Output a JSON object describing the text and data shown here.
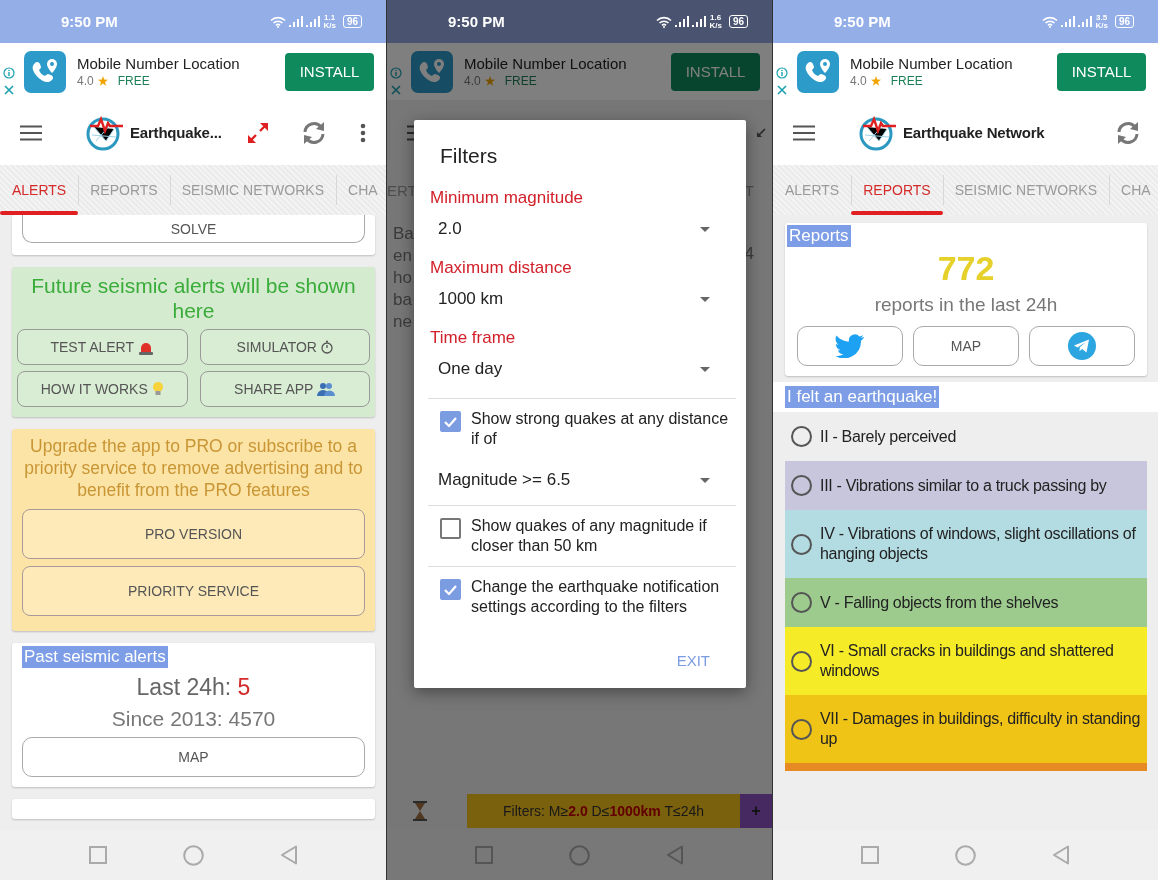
{
  "screens": [
    {
      "kind": "alerts",
      "status_bar": {
        "time": "9:50 PM",
        "speed": "1.1",
        "speed_unit": "K/s",
        "battery": "96"
      },
      "ad": {
        "title": "Mobile Number Location",
        "rating": "4.0",
        "price": "FREE",
        "button": "INSTALL"
      },
      "toolbar": {
        "title": "Earthquake..."
      },
      "tabs": [
        {
          "label": "ALERTS",
          "selected": true
        },
        {
          "label": "REPORTS",
          "selected": false
        },
        {
          "label": "SEISMIC NETWORKS",
          "selected": false
        },
        {
          "label": "CHA",
          "selected": false
        }
      ],
      "solve_button": "SOLVE",
      "future_card": {
        "message": "Future seismic alerts will be shown here",
        "buttons": [
          {
            "label": "TEST ALERT",
            "kind": "siren"
          },
          {
            "label": "SIMULATOR",
            "kind": "timer"
          },
          {
            "label": "HOW IT WORKS",
            "kind": "bulb"
          },
          {
            "label": "SHARE APP",
            "kind": "people"
          }
        ]
      },
      "upgrade_card": {
        "message": "Upgrade the app to PRO or subscribe to a priority service to remove advertising and to benefit from the PRO features",
        "buttons": [
          "PRO VERSION",
          "PRIORITY SERVICE"
        ]
      },
      "past_alerts": {
        "title": "Past seismic alerts",
        "last_label": "Last 24h:",
        "last_value": "5",
        "since": "Since 2013: 4570",
        "button": "MAP"
      }
    },
    {
      "kind": "filters",
      "status_bar": {
        "time": "9:50 PM",
        "speed": "1.6",
        "speed_unit": "K/s",
        "battery": "96"
      },
      "ad": {
        "title": "Mobile Number Location",
        "rating": "4.0",
        "price": "FREE",
        "button": "INSTALL"
      },
      "background": {
        "tab_fragments": [
          "ERT",
          "T"
        ],
        "text_fragments": [
          "Ba",
          "en",
          "ho",
          "ba",
          "ne"
        ],
        "side_fragment": "4",
        "filter_bar": "Filters: M≥**2.0** D≤**1000km** T≤24h",
        "add_button": "+"
      },
      "dialog": {
        "title": "Filters",
        "fields": [
          {
            "label": "Minimum magnitude",
            "value": "2.0"
          },
          {
            "label": "Maximum distance",
            "value": "1000 km"
          },
          {
            "label": "Time frame",
            "value": "One day"
          }
        ],
        "options": [
          {
            "kind": "checkbox",
            "label": "Show strong quakes at any distance if of",
            "checked": true
          },
          {
            "kind": "dropdown",
            "value": "Magnitude >= 6.5"
          },
          {
            "kind": "checkbox",
            "label": "Show quakes of any magnitude if closer than 50 km",
            "checked": false
          },
          {
            "kind": "checkbox",
            "label": "Change the earthquake notification settings according to the filters",
            "checked": true
          }
        ],
        "button": "EXIT"
      }
    },
    {
      "kind": "reports",
      "status_bar": {
        "time": "9:50 PM",
        "speed": "3.5",
        "speed_unit": "K/s",
        "battery": "96"
      },
      "ad": {
        "title": "Mobile Number Location",
        "rating": "4.0",
        "price": "FREE",
        "button": "INSTALL"
      },
      "toolbar": {
        "title": "Earthquake Network"
      },
      "tabs": [
        {
          "label": "ALERTS",
          "selected": false
        },
        {
          "label": "REPORTS",
          "selected": true
        },
        {
          "label": "SEISMIC NETWORKS",
          "selected": false
        },
        {
          "label": "CHA",
          "selected": false
        }
      ],
      "reports_card": {
        "title": "Reports",
        "count": "772",
        "caption": "reports in the last 24h",
        "map_button": "MAP"
      },
      "felt": {
        "title": "I felt an earthquake!",
        "peek": {
          "color": "#e68a24"
        },
        "levels": [
          {
            "label": "II - Barely perceived",
            "color": "#eeeeee",
            "selected": false
          },
          {
            "label": "III - Vibrations similar to a truck passing by",
            "color": "#c7c6dc",
            "selected": false
          },
          {
            "label": "IV - Vibrations of windows, slight oscillations of hanging objects",
            "color": "#b3dbe2",
            "selected": false
          },
          {
            "label": "V - Falling objects from the shelves",
            "color": "#9dcb8e",
            "selected": false
          },
          {
            "label": "VI - Small cracks in buildings and shattered windows",
            "color": "#f6eb27",
            "selected": false
          },
          {
            "label": "VII - Damages in buildings, difficulty in standing up",
            "color": "#f0c417",
            "selected": false
          }
        ]
      }
    }
  ]
}
